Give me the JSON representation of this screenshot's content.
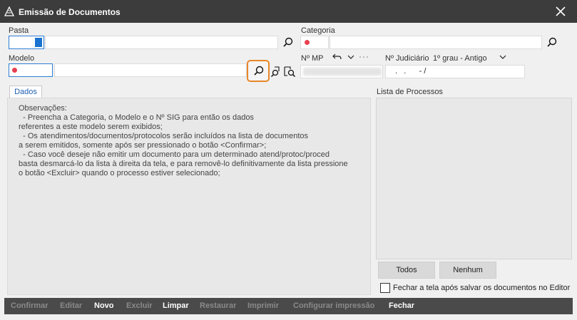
{
  "window": {
    "title": "Emissão de Documentos"
  },
  "pasta": {
    "label": "Pasta",
    "value": ""
  },
  "categoria": {
    "label": "Categoria",
    "value": ""
  },
  "modelo": {
    "label": "Modelo",
    "value": ""
  },
  "num_mp": {
    "label": "Nº MP",
    "value": ""
  },
  "num_judiciario": {
    "label": "Nº Judiciário",
    "grau": "1º grau - Antigo",
    "value": " .   .      - /"
  },
  "tab": {
    "label": "Dados"
  },
  "observacoes": [
    "Observações:",
    "  - Preencha a Categoria, o Modelo e o Nº SIG para então os dados",
    "referentes a este modelo serem exibidos;",
    "  - Os atendimentos/documentos/protocolos serão incluídos na lista de documentos",
    "a serem emitidos, somente após ser pressionado o botão <Confirmar>;",
    "  - Caso você deseje não emitir um documento para um determinado atend/protoc/proced",
    "basta desmarcá-lo da lista à direita da tela, e para removê-lo definitivamente da lista pressione",
    "o botão <Excluir> quando o processo estiver selecionado;"
  ],
  "lista": {
    "label": "Lista de Processos"
  },
  "buttons": {
    "todos": "Todos",
    "nenhum": "Nenhum"
  },
  "fechar_checkbox": {
    "label": "Fechar a tela após salvar os documentos no Editor",
    "checked": false
  },
  "toolbar": {
    "confirmar": "Confirmar",
    "editar": "Editar",
    "novo": "Novo",
    "excluir": "Excluir",
    "limpar": "Limpar",
    "restaurar": "Restaurar",
    "imprimir": "Imprimir",
    "configurar": "Configurar impressão",
    "fechar": "Fechar"
  },
  "colors": {
    "accent": "#2f7fd6",
    "required": "#e8404f",
    "highlight": "#e8872a"
  }
}
